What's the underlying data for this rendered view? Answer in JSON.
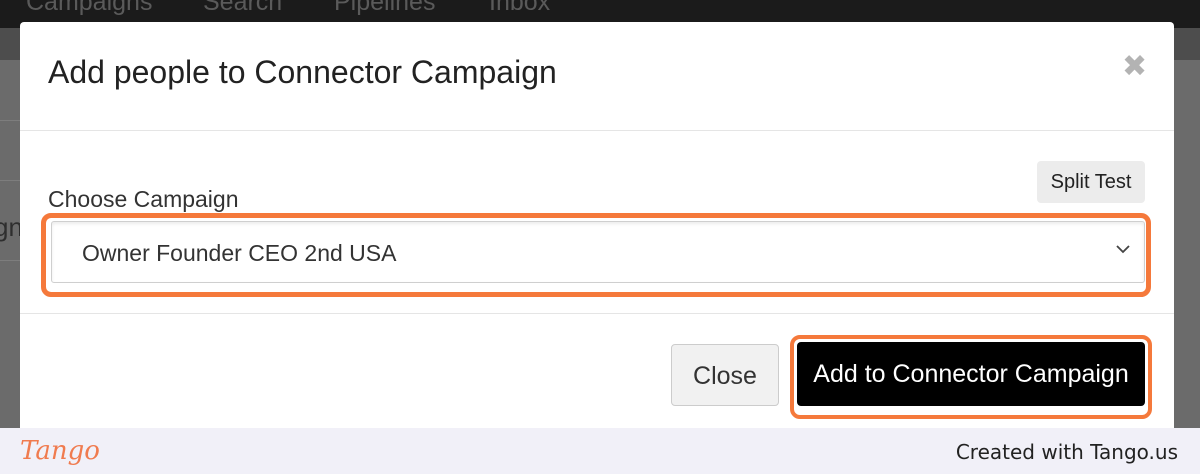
{
  "background": {
    "nav_items": [
      "Campaigns",
      "Search",
      "Pipelines",
      "Inbox"
    ],
    "left_fragment": "gn"
  },
  "modal": {
    "title": "Add people to Connector Campaign",
    "close_icon": "times-icon",
    "field_label": "Choose Campaign",
    "split_test_label": "Split Test",
    "select": {
      "value": "Owner Founder CEO 2nd USA",
      "icon": "chevron-down-icon"
    },
    "footer": {
      "close_label": "Close",
      "primary_label": "Add to Connector Campaign"
    }
  },
  "tango": {
    "logo": "Tango",
    "credit": "Created with Tango.us"
  },
  "colors": {
    "highlight": "#f5793b",
    "primary_button": "#000000",
    "tango_brand": "#f07b4f"
  }
}
